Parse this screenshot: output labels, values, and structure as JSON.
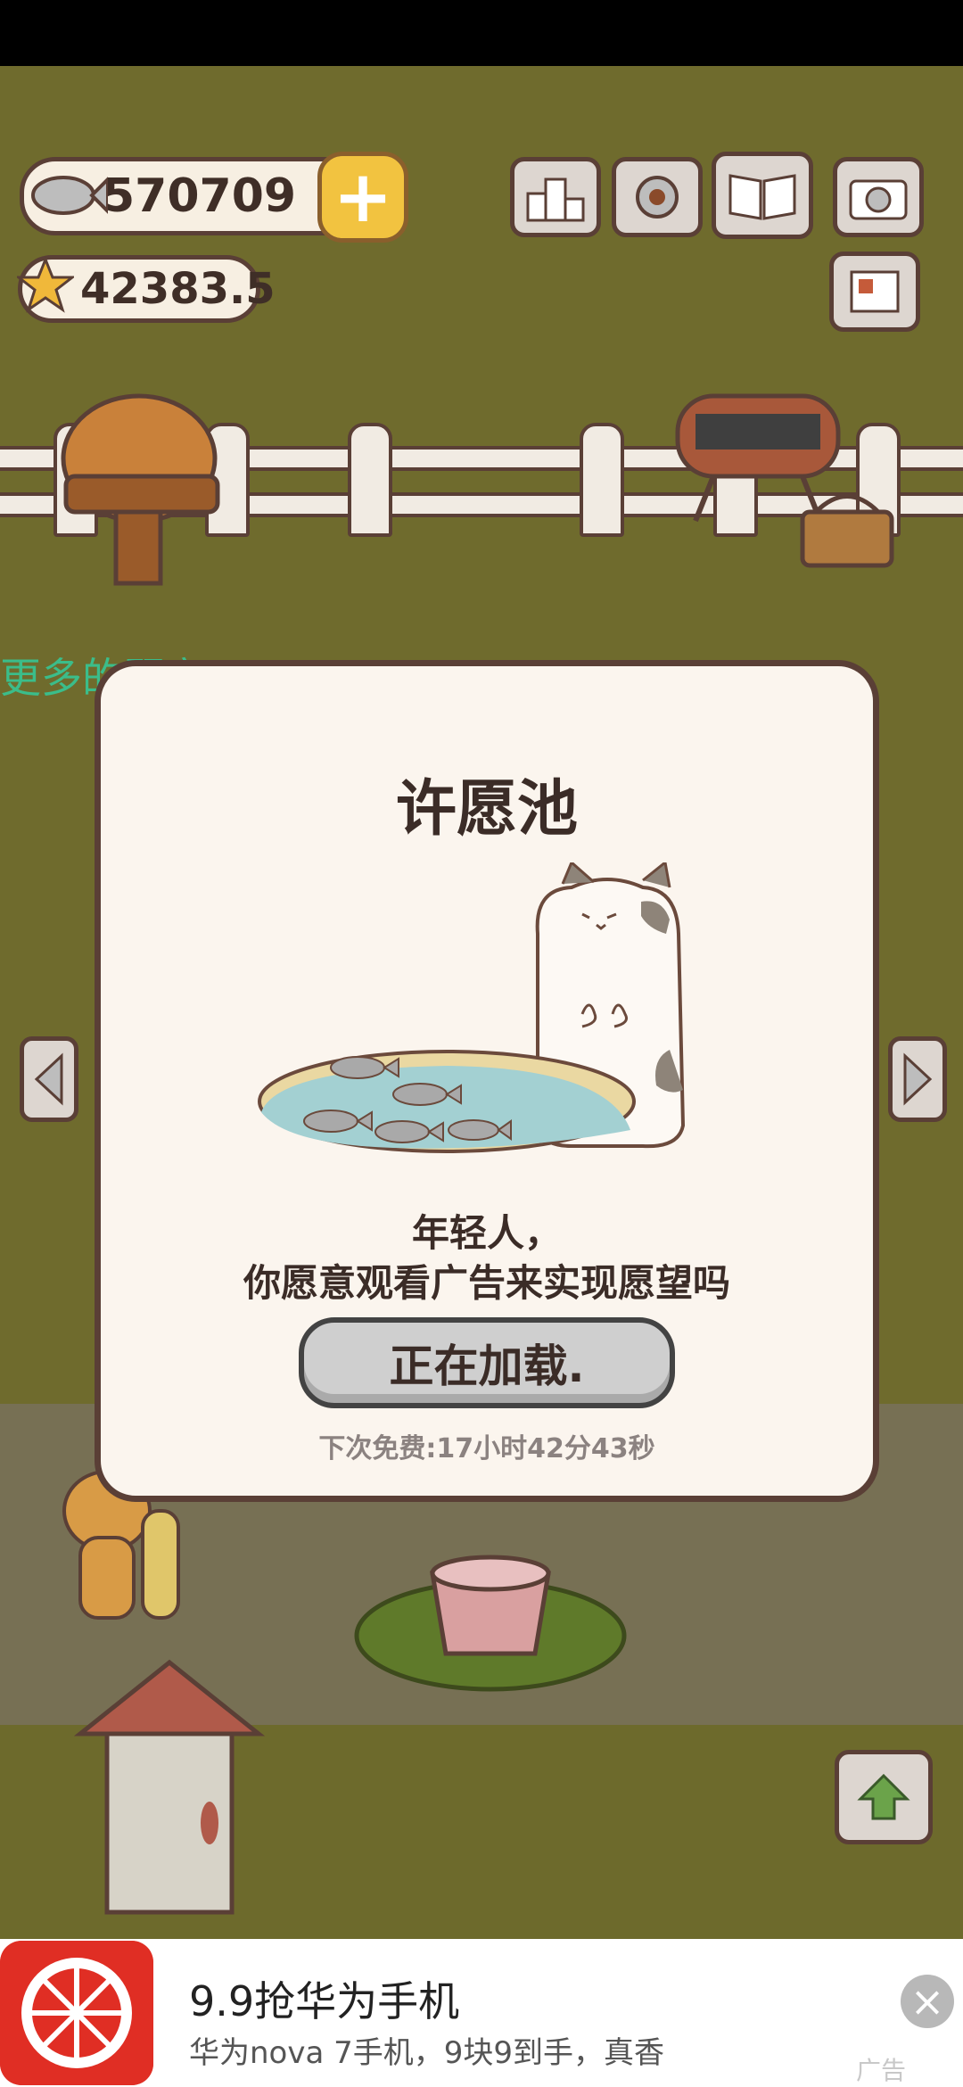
{
  "hud": {
    "fish_count": "570709",
    "star_count": "42383.5",
    "plus_icon": "plus-icon"
  },
  "hint_text": "更多的顾客",
  "dialog": {
    "title": "许愿池",
    "message_line1": "年轻人，",
    "message_line2": "你愿意观看广告来实现愿望吗",
    "button_label": "正在加载.",
    "next_free": "下次免费:17小时42分43秒"
  },
  "ad": {
    "title": "9.9抢华为手机",
    "subtitle": "华为nova 7手机，9块9到手，真香",
    "tag": "广告",
    "brand_color": "#e02e24"
  }
}
